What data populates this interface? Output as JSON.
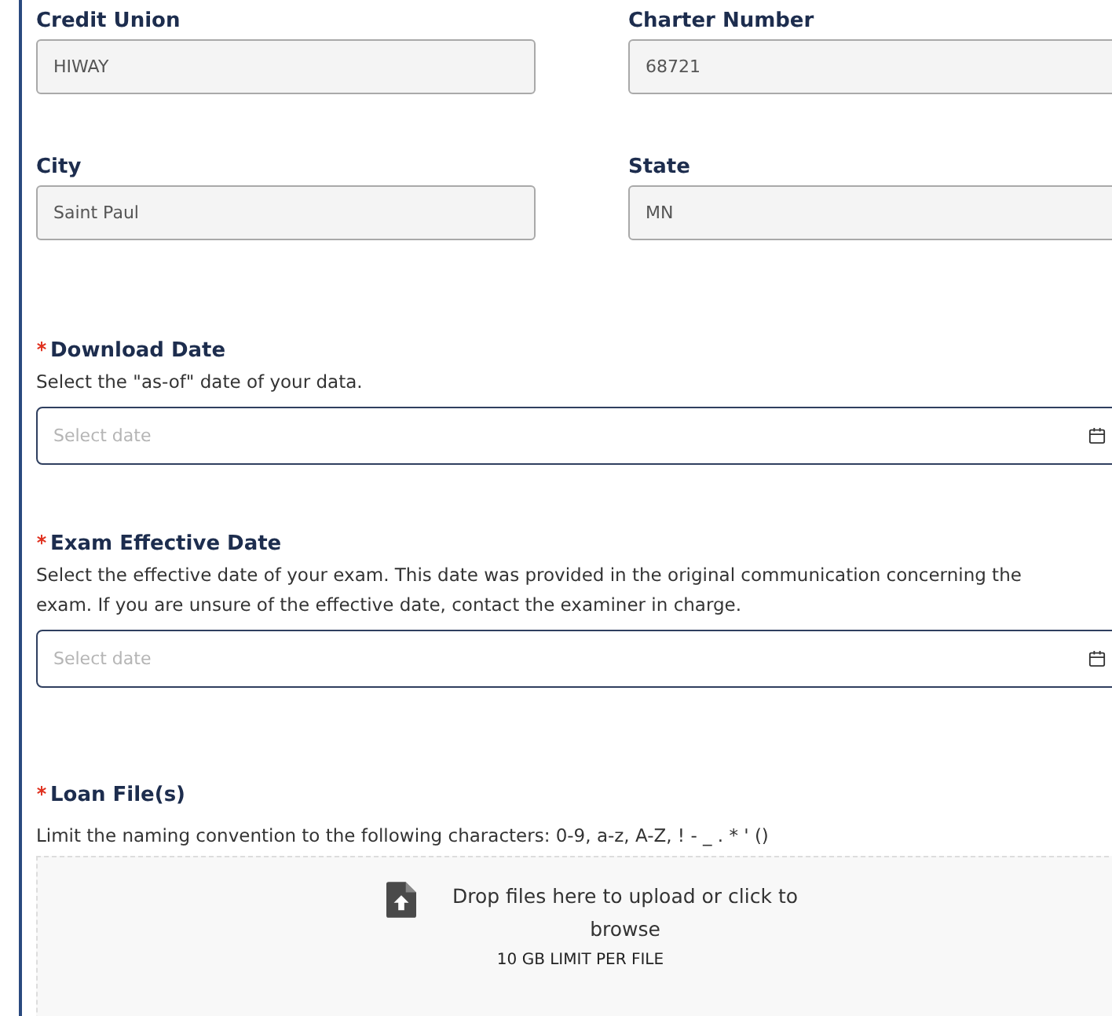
{
  "info_fields": [
    {
      "label": "Credit Union",
      "value": "HIWAY"
    },
    {
      "label": "Charter Number",
      "value": "68721"
    },
    {
      "label": "City",
      "value": "Saint Paul"
    },
    {
      "label": "State",
      "value": "MN"
    }
  ],
  "date_fields": [
    {
      "label": "Download Date",
      "required": true,
      "help": "Select the \"as-of\" date of your data.",
      "placeholder": "Select date"
    },
    {
      "label": "Exam Effective Date",
      "required": true,
      "help": "Select the effective date of your exam. This date was provided in the original communication concerning the exam. If you are unsure of the effective date, contact the examiner in charge.",
      "placeholder": "Select date"
    }
  ],
  "upload": {
    "label": "Loan File(s)",
    "required": true,
    "help": "Limit the naming convention to the following characters: 0-9, a-z, A-Z, ! - _ . * ' ()",
    "prompt": "Drop files here to upload or click to browse",
    "limit": "10 GB LIMIT PER FILE"
  }
}
